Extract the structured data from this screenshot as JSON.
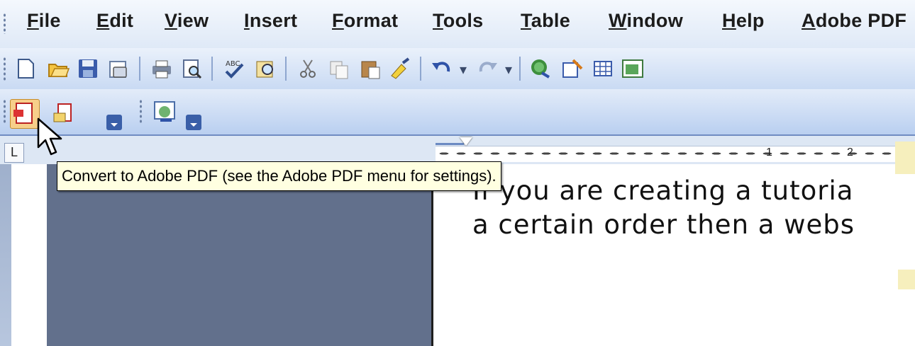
{
  "menu": {
    "items": [
      {
        "label": "File"
      },
      {
        "label": "Edit"
      },
      {
        "label": "View"
      },
      {
        "label": "Insert"
      },
      {
        "label": "Format"
      },
      {
        "label": "Tools"
      },
      {
        "label": "Table"
      },
      {
        "label": "Window"
      },
      {
        "label": "Help"
      },
      {
        "label": "Adobe PDF"
      }
    ]
  },
  "toolbar": {
    "standard_icons": [
      "new-document-icon",
      "open-folder-icon",
      "save-icon",
      "permission-icon",
      "print-icon",
      "print-preview-icon",
      "spelling-icon",
      "research-icon",
      "cut-icon",
      "copy-icon",
      "paste-icon",
      "format-painter-icon",
      "undo-icon",
      "redo-icon",
      "hyperlink-icon",
      "tables-borders-icon",
      "insert-table-icon",
      "insert-excel-icon"
    ],
    "pdf_icons": [
      "convert-to-pdf-icon",
      "convert-and-email-icon",
      "send-for-review-icon"
    ]
  },
  "tooltip": {
    "text": "Convert to Adobe PDF (see the Adobe PDF menu for settings)."
  },
  "ruler": {
    "tab_symbol": "L",
    "numbers": [
      "1",
      "2"
    ]
  },
  "document": {
    "lines": [
      "If you are creating a tutoria",
      "a certain order then a webs"
    ]
  },
  "colors": {
    "menu_bg": "#dfe9f7",
    "toolbar_bg": "#c9daf3",
    "panel_grey": "#62708c",
    "tooltip_bg": "#ffffe1",
    "highlight": "#f6efbd"
  }
}
